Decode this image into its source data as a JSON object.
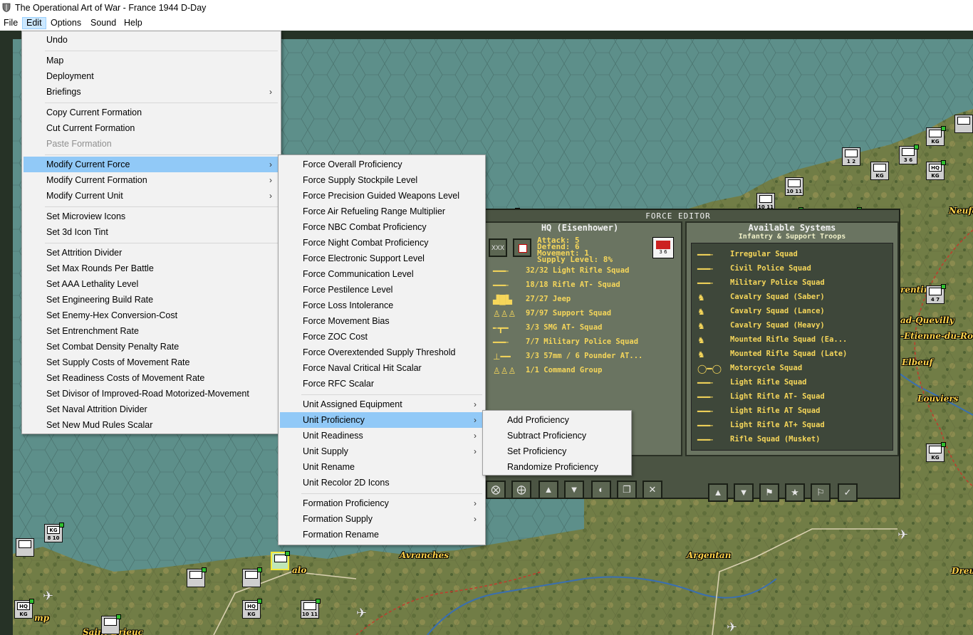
{
  "window": {
    "title": "The Operational Art of War - France 1944 D-Day"
  },
  "menubar": {
    "items": [
      "File",
      "Edit",
      "Options",
      "Sound",
      "Help"
    ],
    "active": "Edit"
  },
  "edit_menu": {
    "undo": "Undo",
    "map": "Map",
    "deployment": "Deployment",
    "briefings": "Briefings",
    "copy_formation": "Copy Current Formation",
    "cut_formation": "Cut Current Formation",
    "paste_formation": "Paste Formation",
    "modify_force": "Modify Current Force",
    "modify_formation": "Modify Current Formation",
    "modify_unit": "Modify Current Unit",
    "microview": "Set Microview Icons",
    "icon_tint": "Set 3d Icon Tint",
    "set_items": [
      "Set Attrition Divider",
      "Set Max Rounds Per Battle",
      "Set AAA Lethality Level",
      "Set Engineering Build Rate",
      "Set Enemy-Hex Conversion-Cost",
      "Set Entrenchment Rate",
      "Set Combat Density Penalty Rate",
      "Set Supply Costs of Movement Rate",
      "Set Readiness Costs of Movement Rate",
      "Set Divisor of Improved-Road Motorized-Movement",
      "Set Naval Attrition Divider",
      "Set New Mud Rules Scalar"
    ]
  },
  "force_menu": {
    "force_items": [
      "Force Overall Proficiency",
      "Force Supply Stockpile Level",
      "Force Precision Guided Weapons Level",
      "Force Air Refueling Range Multiplier",
      "Force NBC Combat Proficiency",
      "Force Night Combat Proficiency",
      "Force Electronic Support Level",
      "Force Communication Level",
      "Force Pestilence Level",
      "Force Loss Intolerance",
      "Force Movement Bias",
      "Force ZOC Cost",
      "Force Overextended Supply Threshold",
      "Force Naval Critical Hit Scalar",
      "Force RFC Scalar"
    ],
    "unit_items": [
      "Unit Assigned Equipment",
      "Unit Proficiency",
      "Unit Readiness",
      "Unit Supply",
      "Unit Rename",
      "Unit Recolor 2D Icons"
    ],
    "formation_items": [
      "Formation Proficiency",
      "Formation Supply",
      "Formation Rename"
    ]
  },
  "proficiency_menu": {
    "items": [
      "Add Proficiency",
      "Subtract Proficiency",
      "Set Proficiency",
      "Randomize Proficiency"
    ]
  },
  "force_editor": {
    "title": "FORCE EDITOR",
    "unit_panel": {
      "heading": "HQ (Eisenhower)",
      "attack": "Attack: 5",
      "defend": "Defend: 6",
      "movement": "Movement: 1",
      "supply": "Supply Level: 8%",
      "badge": "3 6",
      "equipment": [
        {
          "icon": "rifle",
          "text": "32/32 Light Rifle Squad"
        },
        {
          "icon": "rifle",
          "text": "18/18 Rifle AT- Squad"
        },
        {
          "icon": "jeep",
          "text": "27/27 Jeep"
        },
        {
          "icon": "troops",
          "text": "97/97 Support Squad"
        },
        {
          "icon": "smg",
          "text": "3/3 SMG AT- Squad"
        },
        {
          "icon": "rifle",
          "text": "7/7 Military Police Squad"
        },
        {
          "icon": "gun",
          "text": "3/3 57mm / 6 Pounder AT..."
        },
        {
          "icon": "troops",
          "text": "1/1 Command Group"
        }
      ]
    },
    "systems_panel": {
      "heading": "Available Systems",
      "subheading": "Infantry & Support Troops",
      "systems": [
        {
          "icon": "rifle",
          "text": "Irregular Squad"
        },
        {
          "icon": "rifle",
          "text": "Civil Police Squad"
        },
        {
          "icon": "rifle",
          "text": "Military Police Squad"
        },
        {
          "icon": "horse",
          "text": "Cavalry Squad (Saber)"
        },
        {
          "icon": "horse",
          "text": "Cavalry Squad (Lance)"
        },
        {
          "icon": "horse",
          "text": "Cavalry Squad (Heavy)"
        },
        {
          "icon": "horse",
          "text": "Mounted Rifle Squad (Ea..."
        },
        {
          "icon": "horse",
          "text": "Mounted Rifle Squad (Late)"
        },
        {
          "icon": "motorcycle",
          "text": "Motorcycle Squad"
        },
        {
          "icon": "rifle",
          "text": "Light Rifle Squad"
        },
        {
          "icon": "rifle",
          "text": "Light Rifle AT- Squad"
        },
        {
          "icon": "rifle",
          "text": "Light Rifle AT Squad"
        },
        {
          "icon": "rifle",
          "text": "Light Rifle AT+ Squad"
        },
        {
          "icon": "rifle",
          "text": "Rifle Squad (Musket)"
        }
      ]
    }
  },
  "map": {
    "towns": [
      "Avranches",
      "Argentan",
      "Louviers",
      "Elbeuf",
      "Neufc",
      "Dreu",
      "-Etienne-du-Rou",
      "ad-Quevilly",
      "rentin",
      "alo",
      "mp",
      "Saint-Brieuc"
    ],
    "unit_labels": [
      "HQ",
      "KG",
      "4 7",
      "3 6",
      "8 10",
      "10 11",
      "1 2"
    ]
  },
  "colors": {
    "highlight": "#91c9f7",
    "menu_bg": "#f2f2f2",
    "editor_text": "#f5d65a",
    "sea": "#5a8f8c",
    "land": "#6d7a45"
  }
}
